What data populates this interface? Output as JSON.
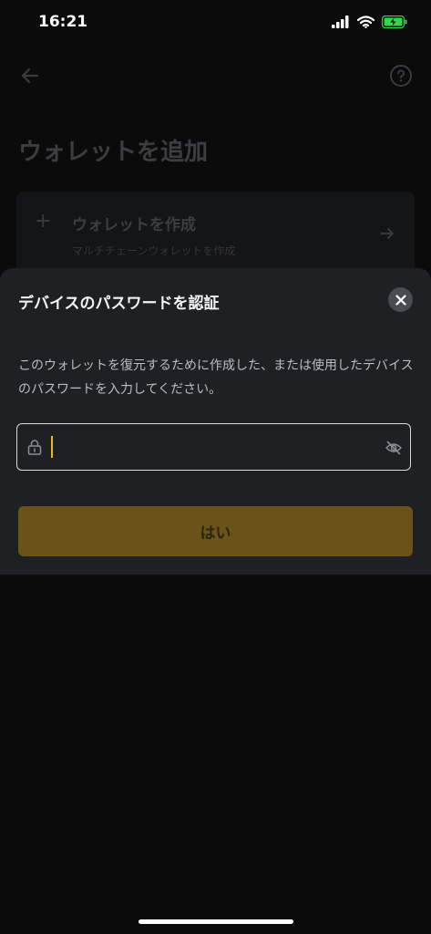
{
  "status_bar": {
    "time": "16:21",
    "icons": [
      "signal-icon",
      "wifi-icon",
      "battery-charging-icon"
    ],
    "battery_color": "#32d74b"
  },
  "background_page": {
    "title": "ウォレットを追加",
    "icons": [
      "back-arrow-icon",
      "help-icon"
    ],
    "create_card": {
      "icon": "plus-icon",
      "title": "ウォレットを作成",
      "subtitle": "マルチチェーンウォレットを作成",
      "arrow_icon": "arrow-right-icon"
    }
  },
  "sheet": {
    "title": "デバイスのパスワードを認証",
    "close_icon": "close-icon",
    "description": "このウォレットを復元するために作成した、または使用したデバイスのパスワードを入力してください。",
    "password_field": {
      "value": "",
      "placeholder": "",
      "lock_icon": "lock-icon",
      "visibility_icon": "eye-off-icon"
    },
    "confirm_label": "はい"
  },
  "colors": {
    "accent": "#f0b90b",
    "button_bg": "#6b5218",
    "sheet_bg": "#1e2024",
    "page_bg": "#0b0b0c"
  }
}
